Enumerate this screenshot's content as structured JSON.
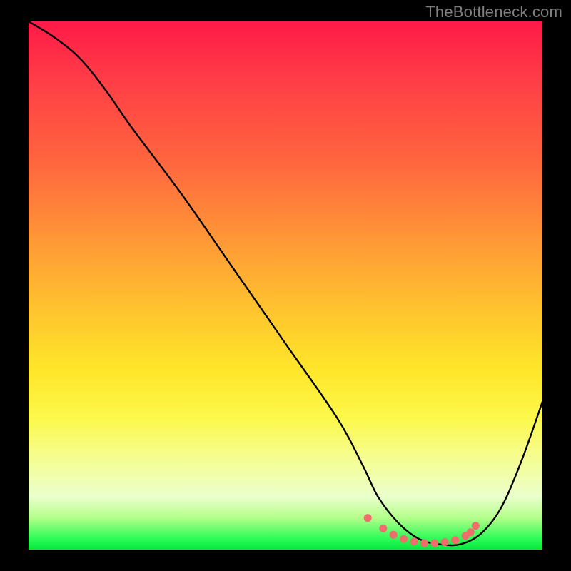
{
  "watermark": "TheBottleneck.com",
  "chart_data": {
    "type": "line",
    "title": "",
    "xlabel": "",
    "ylabel": "",
    "note": "Axes unlabeled; only curve shape is readable. x normalized 0–1 across plot width, y normalized 0–1 across plot height (1 = top).",
    "xlim": [
      0,
      1
    ],
    "ylim": [
      0,
      1
    ],
    "series": [
      {
        "name": "main-curve",
        "x": [
          0.0,
          0.05,
          0.1,
          0.15,
          0.2,
          0.3,
          0.4,
          0.5,
          0.6,
          0.65,
          0.68,
          0.72,
          0.76,
          0.8,
          0.84,
          0.88,
          0.92,
          0.96,
          1.0
        ],
        "y": [
          1.0,
          0.97,
          0.93,
          0.87,
          0.8,
          0.67,
          0.53,
          0.39,
          0.25,
          0.16,
          0.1,
          0.05,
          0.02,
          0.01,
          0.01,
          0.03,
          0.08,
          0.17,
          0.28
        ]
      },
      {
        "name": "trough-dots",
        "x": [
          0.66,
          0.69,
          0.71,
          0.73,
          0.75,
          0.77,
          0.79,
          0.81,
          0.83,
          0.85,
          0.86,
          0.87
        ],
        "y": [
          0.06,
          0.04,
          0.028,
          0.02,
          0.015,
          0.012,
          0.012,
          0.014,
          0.018,
          0.026,
          0.033,
          0.045
        ]
      }
    ],
    "background_gradient": {
      "stops": [
        {
          "pos": 0.0,
          "color": "#ff1a48"
        },
        {
          "pos": 0.28,
          "color": "#ff6a3e"
        },
        {
          "pos": 0.55,
          "color": "#ffc52e"
        },
        {
          "pos": 0.75,
          "color": "#fcf84a"
        },
        {
          "pos": 0.94,
          "color": "#b3ff8a"
        },
        {
          "pos": 1.0,
          "color": "#05e83c"
        }
      ]
    }
  }
}
